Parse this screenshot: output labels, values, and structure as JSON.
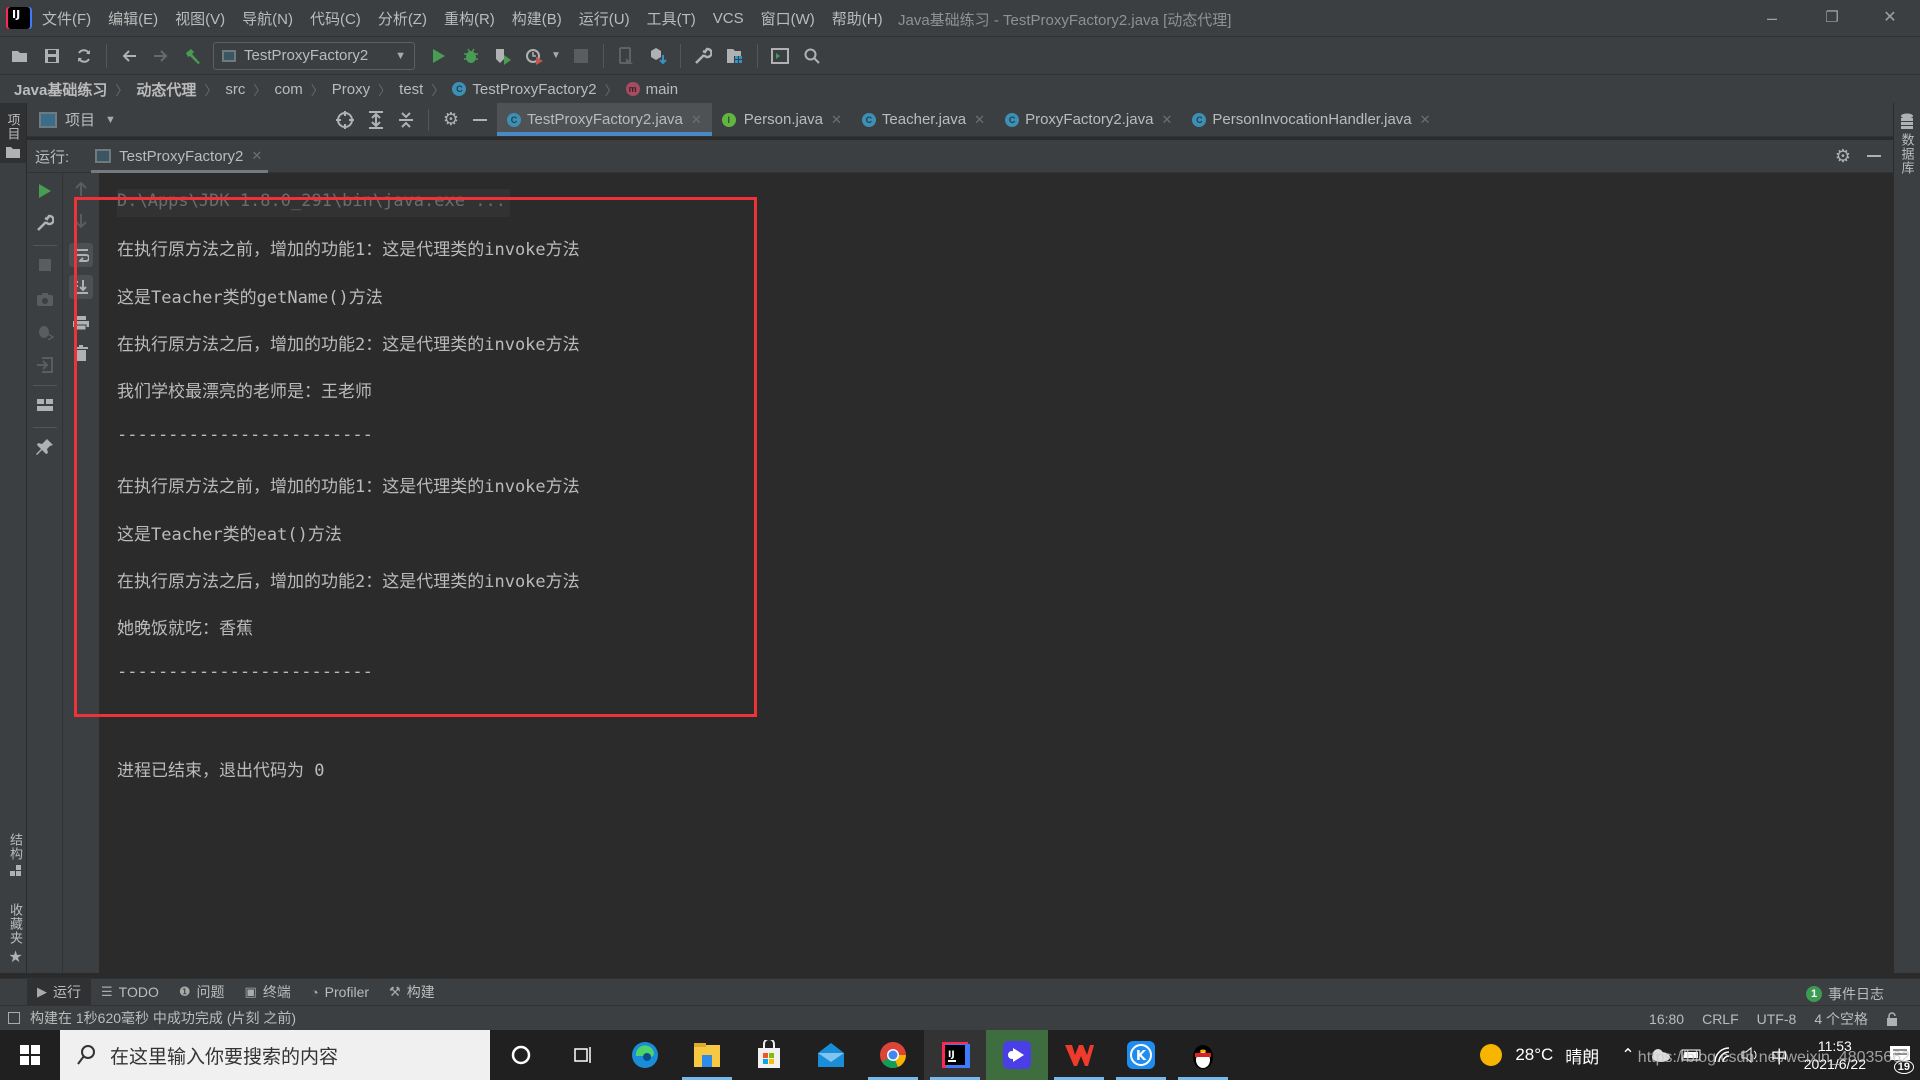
{
  "window": {
    "title": "Java基础练习 - TestProxyFactory2.java [动态代理]",
    "controls": {
      "minimize": "–",
      "restore": "❐",
      "close": "✕"
    }
  },
  "menu": [
    "文件(F)",
    "编辑(E)",
    "视图(V)",
    "导航(N)",
    "代码(C)",
    "分析(Z)",
    "重构(R)",
    "构建(B)",
    "运行(U)",
    "工具(T)",
    "VCS",
    "窗口(W)",
    "帮助(H)"
  ],
  "toolbar": {
    "run_config": "TestProxyFactory2",
    "icons": [
      "open-folder-icon",
      "save-icon",
      "sync-icon",
      "back-icon",
      "forward-icon",
      "build-hammer-icon",
      "run-icon",
      "debug-icon",
      "coverage-icon",
      "profile-icon",
      "stop-icon",
      "device-icon",
      "sdk-icon",
      "settings-wrench-icon",
      "project-structure-icon",
      "terminal-icon",
      "search-icon"
    ]
  },
  "breadcrumb": [
    "Java基础练习",
    "动态代理",
    "src",
    "com",
    "Proxy",
    "test",
    "TestProxyFactory2",
    "main"
  ],
  "project_panel": {
    "label": "项目",
    "strip_label": "项目"
  },
  "left_strip_bottom": {
    "structure": "结构",
    "favorites": "收藏夹"
  },
  "right_strip": {
    "database": "数据库"
  },
  "editor_tabs": [
    {
      "label": "TestProxyFactory2.java",
      "kind": "class-run",
      "active": true
    },
    {
      "label": "Person.java",
      "kind": "interface",
      "active": false
    },
    {
      "label": "Teacher.java",
      "kind": "class",
      "active": false
    },
    {
      "label": "ProxyFactory2.java",
      "kind": "class",
      "active": false
    },
    {
      "label": "PersonInvocationHandler.java",
      "kind": "class",
      "active": false
    }
  ],
  "run_panel": {
    "label": "运行:",
    "tab": "TestProxyFactory2",
    "console": {
      "command": "D:\\Apps\\JDK 1.8.0_291\\bin\\java.exe ...",
      "lines": [
        "在执行原方法之前，增加的功能1：这是代理类的invoke方法",
        "这是Teacher类的getName()方法",
        "在执行原方法之后，增加的功能2：这是代理类的invoke方法",
        "我们学校最漂亮的老师是：王老师",
        "-------------------------",
        "在执行原方法之前，增加的功能1：这是代理类的invoke方法",
        "这是Teacher类的eat()方法",
        "在执行原方法之后，增加的功能2：这是代理类的invoke方法",
        "她晚饭就吃：香蕉",
        "-------------------------"
      ],
      "exit_message": "进程已结束，退出代码为 0"
    }
  },
  "bottom_tools": [
    {
      "label": "运行",
      "icon": "▶",
      "active": true
    },
    {
      "label": "TODO",
      "icon": "☰",
      "active": false
    },
    {
      "label": "问题",
      "icon": "❶",
      "active": false
    },
    {
      "label": "终端",
      "icon": "▣",
      "active": false
    },
    {
      "label": "Profiler",
      "icon": "◔",
      "active": false
    },
    {
      "label": "构建",
      "icon": "⚒",
      "active": false
    }
  ],
  "event_log": {
    "count": "1",
    "label": "事件日志"
  },
  "status": {
    "message": "构建在 1秒620毫秒 中成功完成 (片刻 之前)",
    "position": "16:80",
    "line_ending": "CRLF",
    "encoding": "UTF-8",
    "indent": "4 个空格"
  },
  "taskbar": {
    "search_placeholder": "在这里输入你要搜索的内容",
    "apps": [
      "cortana",
      "task-view",
      "edge",
      "file-explorer",
      "store",
      "mail",
      "chrome",
      "intellij",
      "video-player",
      "wps",
      "kugou",
      "qq"
    ],
    "weather": {
      "temp": "28°C",
      "condition": "晴朗"
    },
    "ime": "中",
    "time": "11:53",
    "date": "2021/6/22",
    "notifications": "19",
    "watermark": "https://blog.csdn.net/weixin_48035662"
  },
  "colors": {
    "accent": "#4a88c7",
    "highlight_box": "#ee3338",
    "run_green": "#499c54"
  }
}
